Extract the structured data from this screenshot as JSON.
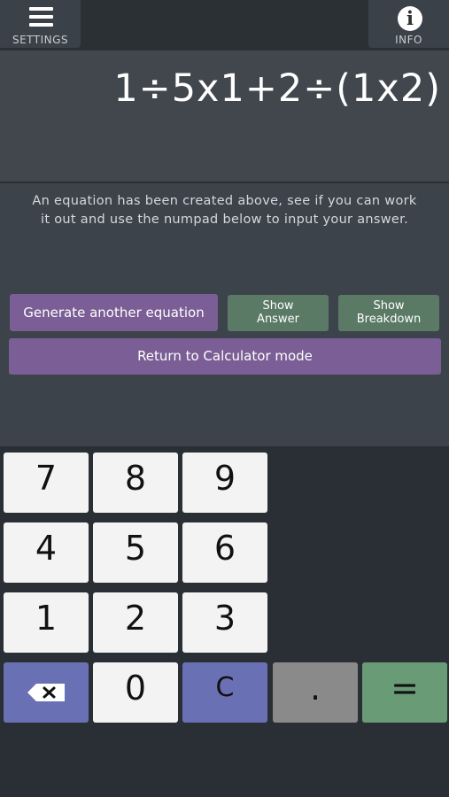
{
  "header": {
    "settings_label": "SETTINGS",
    "info_label": "INFO"
  },
  "display": {
    "equation": "1÷5x1+2÷(1x2)"
  },
  "instructions": {
    "line1": "An equation has been created above, see if you can work",
    "line2": "it out and use the numpad below to input your answer."
  },
  "actions": {
    "generate_label": "Generate another equation",
    "show_answer_line1": "Show",
    "show_answer_line2": "Answer",
    "show_breakdown_line1": "Show",
    "show_breakdown_line2": "Breakdown",
    "return_label": "Return to Calculator mode"
  },
  "numpad": {
    "k7": "7",
    "k8": "8",
    "k9": "9",
    "k4": "4",
    "k5": "5",
    "k6": "6",
    "k1": "1",
    "k2": "2",
    "k3": "3",
    "k0": "0",
    "clear": "C",
    "decimal": ".",
    "equals": "=",
    "backspace_icon": "backspace-icon"
  },
  "colors": {
    "purple": "#7a5e95",
    "green": "#5a7a66",
    "blue_key": "#6a70b4",
    "equals_key": "#6a9b77"
  }
}
